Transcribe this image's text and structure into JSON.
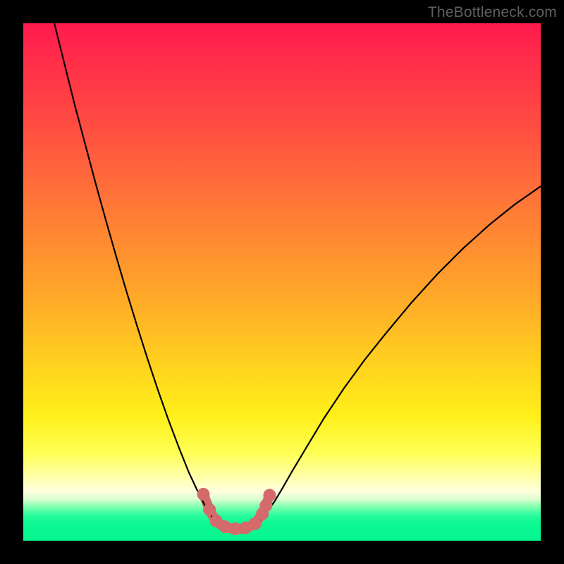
{
  "watermark": "TheBottleneck.com",
  "chart_data": {
    "type": "line",
    "title": "",
    "xlabel": "",
    "ylabel": "",
    "xlim": [
      0,
      100
    ],
    "ylim": [
      0,
      100
    ],
    "series": [
      {
        "name": "left-branch",
        "stroke": "#000000",
        "stroke_width": 2.2,
        "x": [
          6,
          8,
          10,
          12,
          14,
          16,
          18,
          20,
          22,
          24,
          26,
          28,
          30,
          32,
          33.5,
          35,
          36,
          37,
          37.8
        ],
        "y": [
          100,
          92,
          84,
          76.5,
          69,
          61.8,
          54.8,
          48,
          41.5,
          35.2,
          29.2,
          23.5,
          18.2,
          13.2,
          10,
          7,
          5.2,
          4,
          3.5
        ]
      },
      {
        "name": "right-branch",
        "stroke": "#000000",
        "stroke_width": 2.2,
        "x": [
          45.2,
          46,
          47,
          48.5,
          50,
          52,
          55,
          58,
          62,
          66,
          70,
          75,
          80,
          85,
          90,
          95,
          100
        ],
        "y": [
          3.5,
          4.2,
          5.5,
          7.5,
          10,
          13.5,
          18.5,
          23.5,
          29.5,
          35,
          40,
          46,
          51.5,
          56.5,
          61,
          65,
          68.5
        ]
      },
      {
        "name": "trough-fill",
        "stroke": "#d46a6a",
        "stroke_width": 14,
        "linecap": "round",
        "x": [
          35,
          36.2,
          37.5,
          39,
          40.5,
          42,
          43.5,
          45,
          46.3,
          47.5
        ],
        "y": [
          8.5,
          5.5,
          3.5,
          2.6,
          2.3,
          2.3,
          2.6,
          3.5,
          5.5,
          8.5
        ]
      }
    ],
    "markers": [
      {
        "series": "trough-markers",
        "fill": "#d46a6a",
        "r": 9,
        "points": [
          {
            "x": 34.8,
            "y": 9.0
          },
          {
            "x": 36.0,
            "y": 6.0
          },
          {
            "x": 37.3,
            "y": 3.8
          },
          {
            "x": 39.0,
            "y": 2.7
          },
          {
            "x": 41.0,
            "y": 2.3
          },
          {
            "x": 43.0,
            "y": 2.5
          },
          {
            "x": 44.8,
            "y": 3.3
          },
          {
            "x": 46.2,
            "y": 5.2
          },
          {
            "x": 47.6,
            "y": 8.8
          },
          {
            "x": 46.9,
            "y": 6.8
          }
        ]
      }
    ]
  }
}
